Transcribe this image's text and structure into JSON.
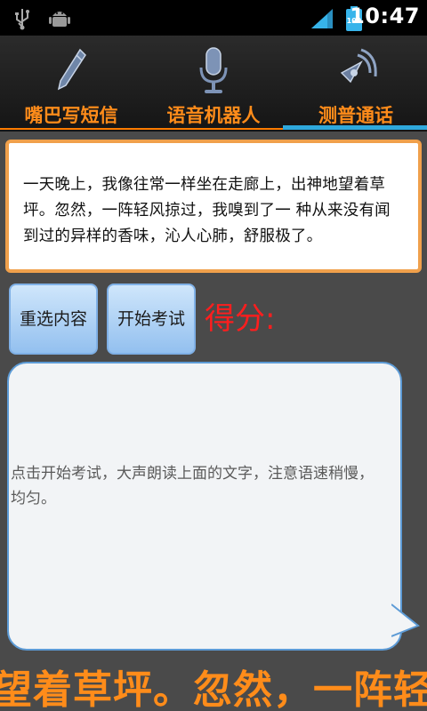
{
  "status_bar": {
    "time": "10:47",
    "battery": "100"
  },
  "tabs": [
    {
      "label": "嘴巴写短信",
      "icon": "pencil-icon"
    },
    {
      "label": "语音机器人",
      "icon": "microphone-icon"
    },
    {
      "label": "测普通话",
      "icon": "speaker-icon",
      "selected": true
    }
  ],
  "reading_text": "一天晚上，我像往常一样坐在走廊上，出神地望着草坪。忽然，一阵轻风掠过，我嗅到了一 种从来没有闻到过的异样的香味，沁人心肺，舒服极了。",
  "buttons": {
    "reselect": "重选内容",
    "start": "开始考试"
  },
  "score_label": "得分:",
  "hint": "点击开始考试，大声朗读上面的文字，注意语速稍慢，均匀。",
  "marquee": "望着草坪。忽然，一阵轻风",
  "colors": {
    "accent": "#ff8c1a",
    "selected_tab": "#2ea8dc",
    "score": "#ff1e1e"
  }
}
